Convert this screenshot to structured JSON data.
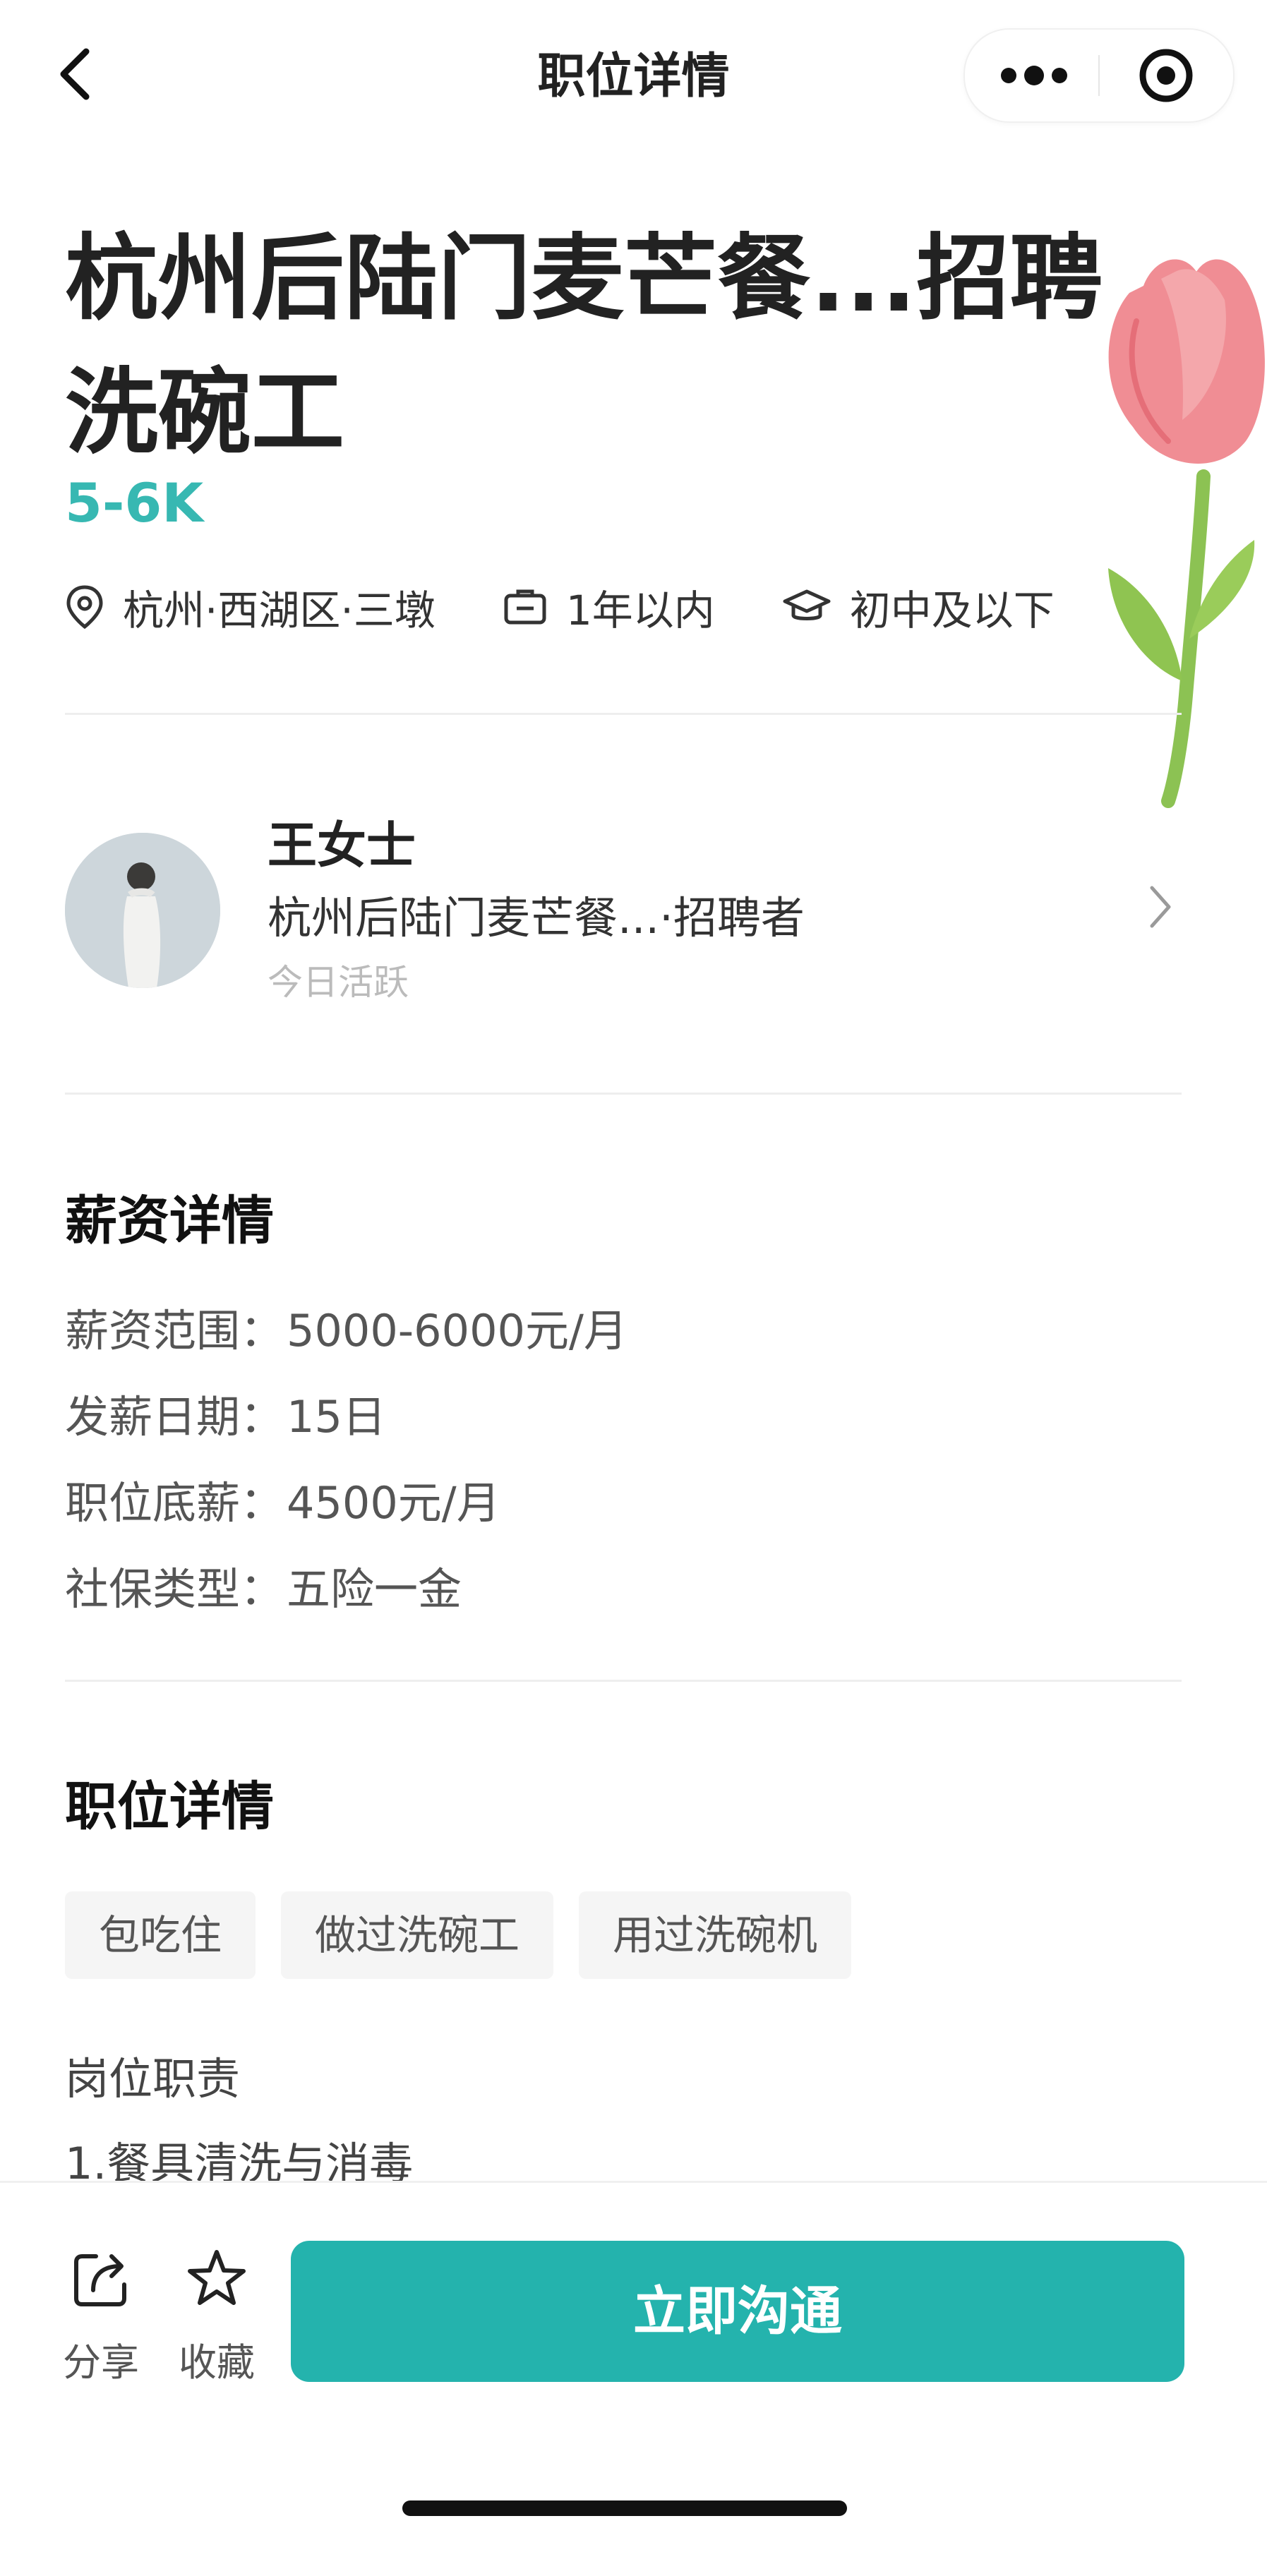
{
  "header": {
    "title": "职位详情",
    "back_icon": "chevron-left",
    "more_icon": "dots-horizontal",
    "close_icon": "target-circle"
  },
  "job": {
    "title": "杭州后陆门麦芒餐...招聘洗碗工",
    "salary": "5-6K",
    "location": "杭州·西湖区·三墩",
    "experience": "1年以内",
    "education": "初中及以下",
    "accent_color": "#37b8b2"
  },
  "recruiter": {
    "name": "王女士",
    "company_role": "杭州后陆门麦芒餐...·招聘者",
    "status": "今日活跃"
  },
  "salary_section": {
    "title": "薪资详情",
    "items": [
      {
        "label": "薪资范围：",
        "value": "5000-6000元/月"
      },
      {
        "label": "发薪日期：",
        "value": "15日"
      },
      {
        "label": "职位底薪：",
        "value": "4500元/月"
      },
      {
        "label": "社保类型：",
        "value": "五险一金"
      }
    ]
  },
  "detail_section": {
    "title": "职位详情",
    "tags": [
      "包吃住",
      "做过洗碗工",
      "用过洗碗机"
    ],
    "duty_title": "岗位职责",
    "duty_first": "1.餐具清洗与消毒"
  },
  "bottom_bar": {
    "share_label": "分享",
    "collect_label": "收藏",
    "chat_label": "立即沟通",
    "button_color": "#24b3ad"
  }
}
